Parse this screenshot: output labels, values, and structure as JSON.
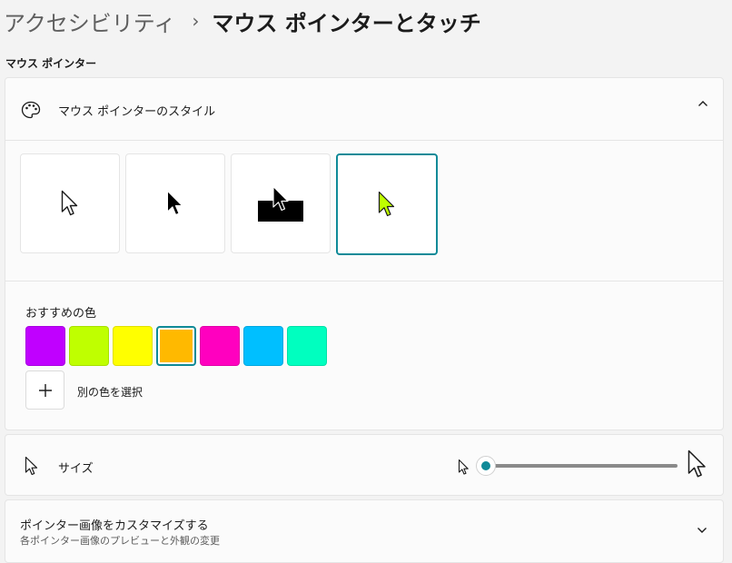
{
  "breadcrumb": {
    "root": "アクセシビリティ",
    "separator": "›",
    "current": "マウス ポインターとタッチ"
  },
  "section_title": "マウス ポインター",
  "style_card": {
    "header_label": "マウス ポインターのスタイル",
    "tiles": [
      {
        "name": "white",
        "selected": false
      },
      {
        "name": "black",
        "selected": false
      },
      {
        "name": "inverted",
        "selected": false
      },
      {
        "name": "custom",
        "selected": true
      }
    ],
    "recommended_label": "おすすめの色",
    "swatches": [
      {
        "color": "#c000ff",
        "selected": false
      },
      {
        "color": "#bfff00",
        "selected": false
      },
      {
        "color": "#ffff00",
        "selected": false
      },
      {
        "color": "#ffb900",
        "selected": true
      },
      {
        "color": "#ff00bf",
        "selected": false
      },
      {
        "color": "#00bfff",
        "selected": false
      },
      {
        "color": "#00ffbf",
        "selected": false
      }
    ],
    "custom_color_label": "別の色を選択",
    "custom_cursor_fill": "#bfff00"
  },
  "size_card": {
    "label": "サイズ",
    "slider_value": 1
  },
  "customize_card": {
    "title": "ポインター画像をカスタマイズする",
    "subtitle": "各ポインター画像のプレビューと外観の変更"
  },
  "colors": {
    "accent": "#0f8a98"
  }
}
